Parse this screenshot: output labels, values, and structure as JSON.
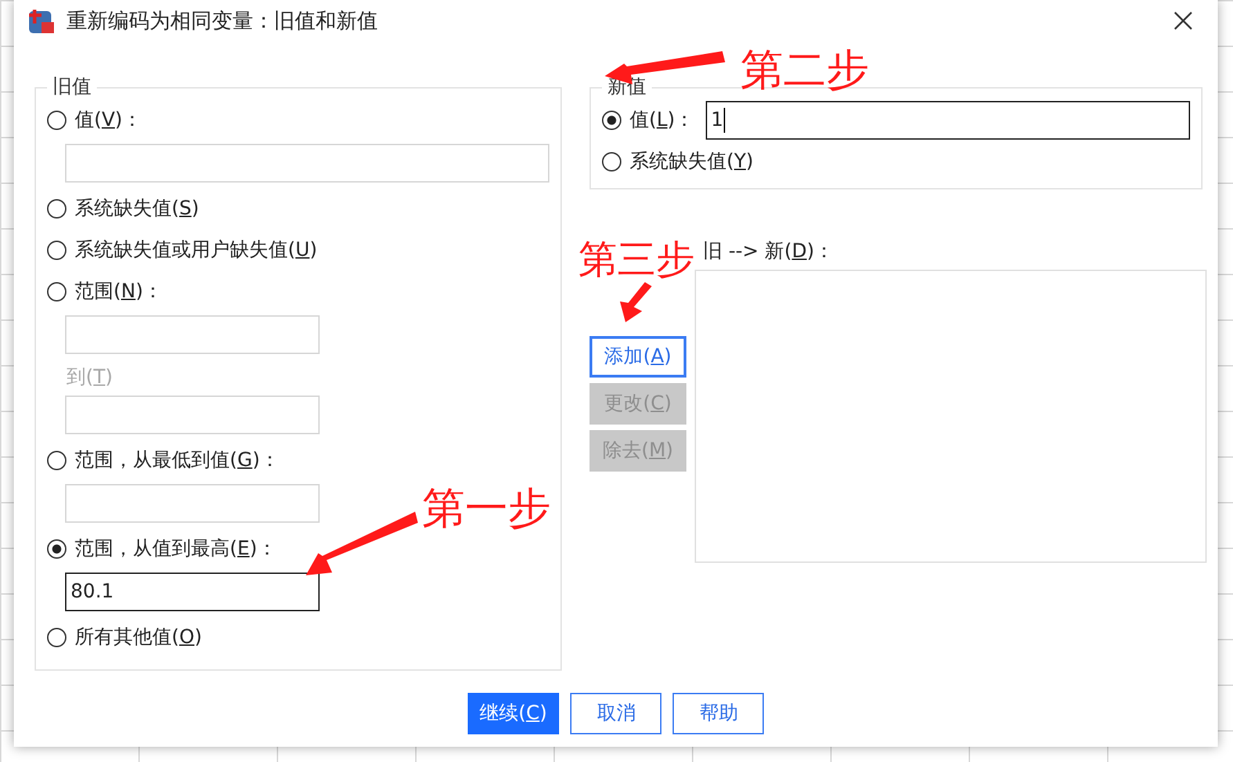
{
  "window": {
    "title": "重新编码为相同变量：旧值和新值"
  },
  "old_value": {
    "legend": "旧值",
    "options": [
      {
        "prefix": "值(",
        "key": "V",
        "suffix": ")：",
        "selected": false,
        "children": [
          {
            "kind": "wide-field",
            "focused": false
          }
        ]
      },
      {
        "prefix": "系统缺失值(",
        "key": "S",
        "suffix": ")",
        "selected": false
      },
      {
        "prefix": "系统缺失值或用户缺失值(",
        "key": "U",
        "suffix": ")",
        "selected": false
      },
      {
        "prefix": "范围(",
        "key": "N",
        "suffix": ")：",
        "selected": false,
        "children": [
          {
            "kind": "field",
            "focused": false
          },
          {
            "kind": "caption",
            "prefix": "到(",
            "key": "T",
            "suffix": ")",
            "disabled": true
          },
          {
            "kind": "field",
            "focused": false
          }
        ]
      },
      {
        "prefix": "范围，从最低到值(",
        "key": "G",
        "suffix": ")：",
        "selected": false,
        "children": [
          {
            "kind": "field",
            "focused": false
          }
        ]
      },
      {
        "prefix": "范围，从值到最高(",
        "key": "E",
        "suffix": ")：",
        "selected": true,
        "children": [
          {
            "kind": "field",
            "focused": true,
            "value": "80.1"
          }
        ]
      },
      {
        "prefix": "所有其他值(",
        "key": "O",
        "suffix": ")",
        "selected": false
      }
    ]
  },
  "new_value": {
    "legend": "新值",
    "options": [
      {
        "prefix": "值(",
        "key": "L",
        "suffix": ")：",
        "selected": true,
        "field": {
          "value": "1",
          "focused": true
        }
      },
      {
        "prefix": "系统缺失值(",
        "key": "Y",
        "suffix": ")",
        "selected": false
      }
    ]
  },
  "mapping": {
    "label": {
      "prefix": "旧 --> 新(",
      "key": "D",
      "suffix": ")："
    }
  },
  "side_buttons": [
    {
      "prefix": "添加(",
      "key": "A",
      "suffix": ")",
      "disabled": false
    },
    {
      "prefix": "更改(",
      "key": "C",
      "suffix": ")",
      "disabled": true
    },
    {
      "prefix": "除去(",
      "key": "M",
      "suffix": ")",
      "disabled": true
    }
  ],
  "footer_buttons": [
    {
      "prefix": "继续(",
      "key": "C",
      "suffix": ")",
      "primary": true
    },
    {
      "prefix": "取消",
      "primary": false
    },
    {
      "prefix": "帮助",
      "primary": false
    }
  ],
  "annotations": [
    {
      "text": "第一步"
    },
    {
      "text": "第二步"
    },
    {
      "text": "第三步"
    }
  ]
}
